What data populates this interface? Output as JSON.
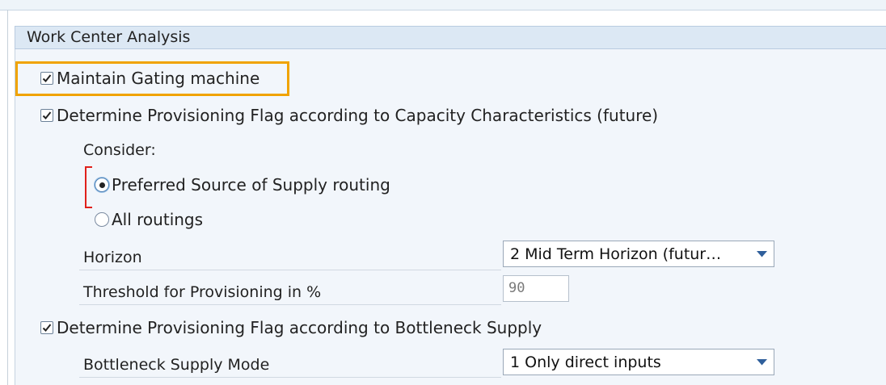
{
  "group": {
    "title": "Work Center Analysis"
  },
  "options": {
    "maintain_gating": {
      "label": "Maintain Gating machine",
      "checked": true
    },
    "capacity_flag": {
      "label": "Determine Provisioning Flag according to Capacity Characteristics (future)",
      "checked": true
    },
    "bottleneck_flag": {
      "label": "Determine Provisioning Flag according to Bottleneck Supply",
      "checked": true
    }
  },
  "consider": {
    "label": "Consider:",
    "radios": [
      {
        "label": "Preferred Source of Supply routing",
        "selected": true
      },
      {
        "label": "All routings",
        "selected": false
      }
    ]
  },
  "horizon": {
    "label": "Horizon",
    "value": "2 Mid Term Horizon (futur…"
  },
  "threshold": {
    "label": "Threshold for Provisioning in %",
    "value": "90"
  },
  "bottleneck_mode": {
    "label": "Bottleneck Supply Mode",
    "value": "1 Only direct inputs"
  },
  "colors": {
    "highlight": "#f0a300",
    "focus_bracket": "#e0201b",
    "header_bg": "#dce8f4",
    "panel_bg": "#f2f6fb"
  },
  "icons": {
    "checkbox": "checkmark-icon",
    "dropdown": "dropdown-caret-icon",
    "radio": "radio-dot-icon"
  }
}
